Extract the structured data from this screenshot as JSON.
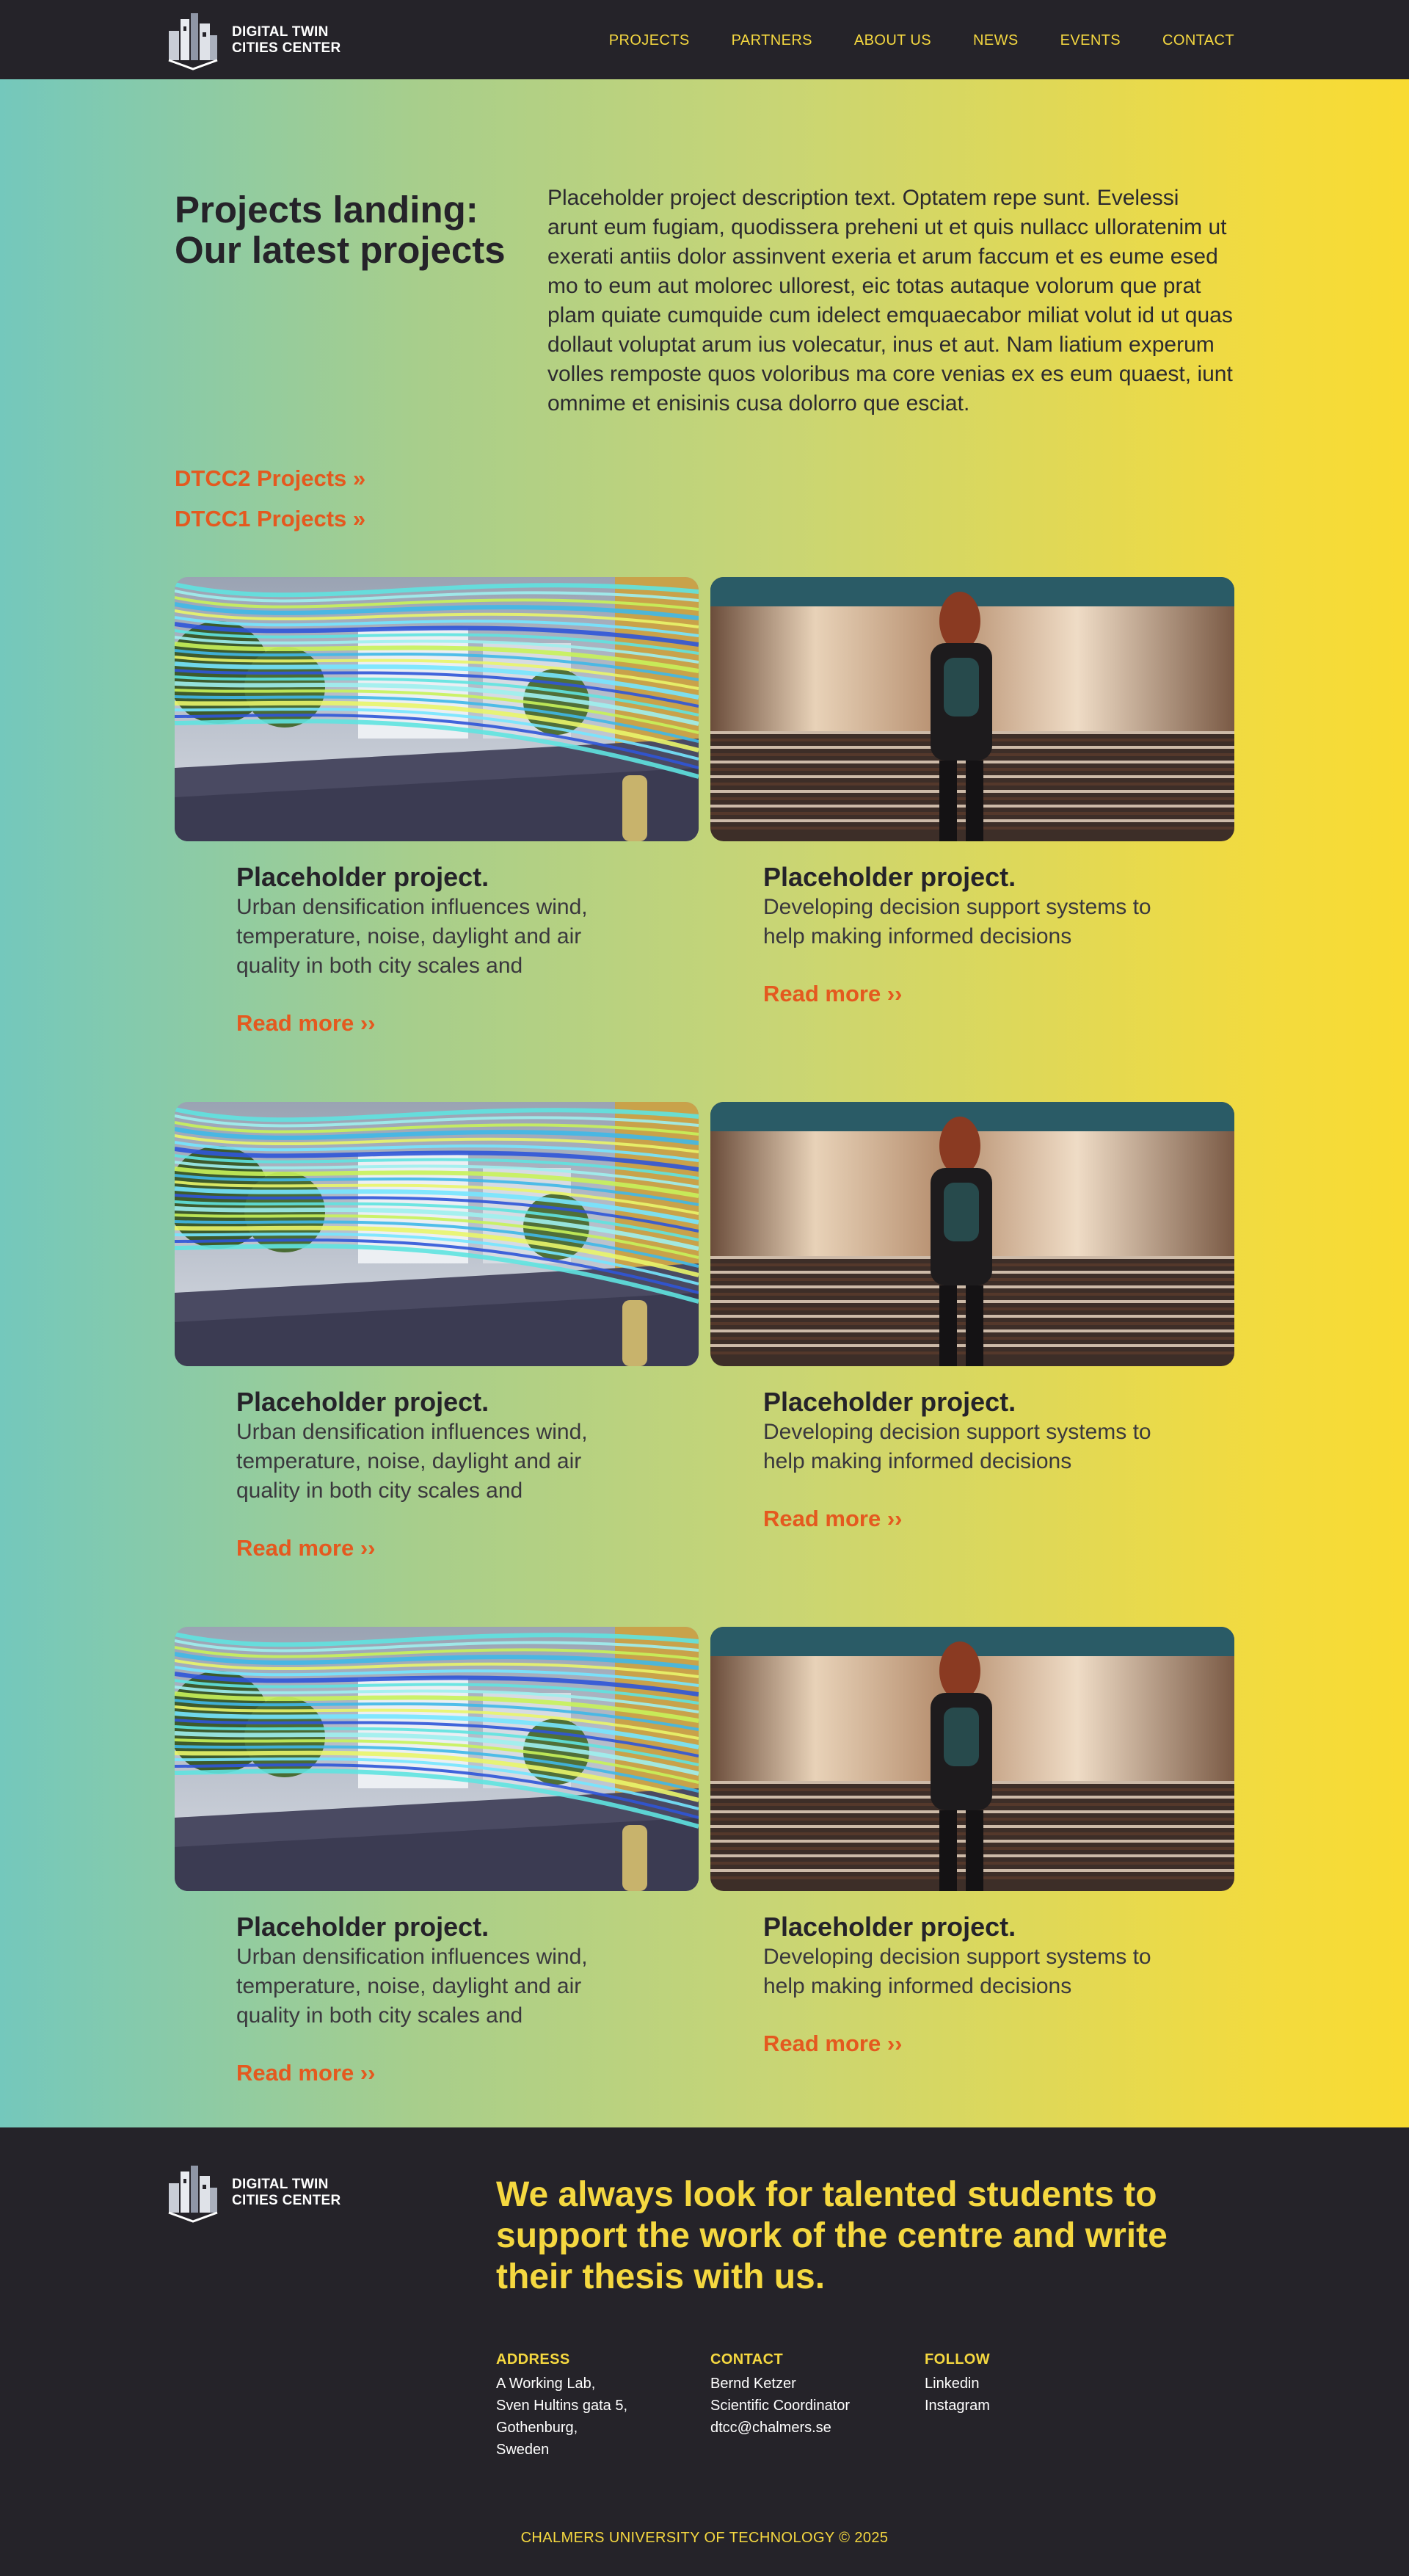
{
  "header": {
    "logo_line1": "DIGITAL TWIN",
    "logo_line2": "CITIES CENTER",
    "nav": [
      "PROJECTS",
      "PARTNERS",
      "ABOUT US",
      "NEWS",
      "EVENTS",
      "CONTACT"
    ]
  },
  "intro": {
    "title": "Projects landing: Our latest projects",
    "links": [
      "DTCC2 Projects »",
      "DTCC1 Projects »"
    ],
    "description": "Placeholder project description text. Optatem repe sunt. Evelessi arunt eum fugiam, quodissera preheni ut et quis nullacc ulloratenim ut exerati antiis dolor assinvent exeria et arum faccum et es eume esed mo to eum aut molorec ullorest, eic totas autaque volorum que prat plam quiate cumquide cum idelect emquaecabor miliat volut id ut quas dollaut voluptat arum ius volecatur, inus et aut. Nam liatium experum volles remposte quos voloribus ma core venias ex es eum quaest, iunt omnime et enisinis cusa dolorro que esciat."
  },
  "cards": [
    [
      {
        "title": "Placeholder project.",
        "text": "Urban densification influences wind, temperature, noise, daylight and air quality in both city scales and",
        "more": "Read more ››",
        "image": "wind-simulation-street-image"
      },
      {
        "title": "Placeholder project.",
        "text": "Developing decision support systems to help making informed decisions",
        "more": "Read more ››",
        "image": "person-at-train-image"
      }
    ],
    [
      {
        "title": "Placeholder project.",
        "text": "Urban densification influences wind, temperature, noise, daylight and air quality in both city scales and",
        "more": "Read more ››",
        "image": "wind-simulation-street-image"
      },
      {
        "title": "Placeholder project.",
        "text": "Developing decision support systems to help making informed decisions",
        "more": "Read more ››",
        "image": "person-at-train-image"
      }
    ],
    [
      {
        "title": "Placeholder project.",
        "text": "Urban densification influences wind, temperature, noise, daylight and air quality in both city scales and",
        "more": "Read more ››",
        "image": "wind-simulation-street-image"
      },
      {
        "title": "Placeholder project.",
        "text": "Developing decision support systems to help making informed decisions",
        "more": "Read more ››",
        "image": "person-at-train-image"
      }
    ]
  ],
  "footer": {
    "logo_line1": "DIGITAL TWIN",
    "logo_line2": "CITIES CENTER",
    "headline": "We always look for talented students to support the work of the centre and write their thesis with us.",
    "address": {
      "heading": "ADDRESS",
      "lines": [
        "A Working Lab,",
        "Sven Hultins gata 5,",
        "Gothenburg,",
        "Sweden"
      ]
    },
    "contact": {
      "heading": "CONTACT",
      "lines": [
        "Bernd Ketzer",
        "Scientific Coordinator",
        "dtcc@chalmers.se"
      ]
    },
    "follow": {
      "heading": "FOLLOW",
      "links": [
        "Linkedin",
        "Instagram"
      ]
    },
    "copyright": "CHALMERS UNIVERSITY OF TECHNOLOGY © 2025"
  },
  "colors": {
    "accent_yellow": "#f5d840",
    "link_orange": "#e4591f",
    "dark": "#252329",
    "gradient_start": "#74c8bc",
    "gradient_end": "#f8db32"
  }
}
